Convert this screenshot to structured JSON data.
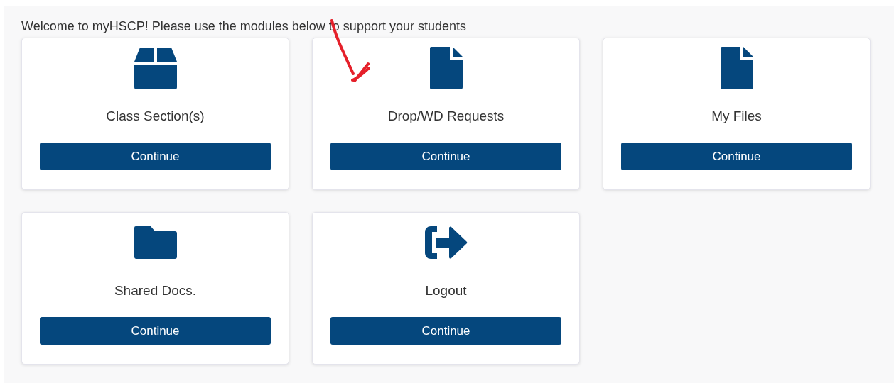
{
  "welcome": "Welcome to myHSCP! Please use the modules below to support your students",
  "modules": [
    {
      "kind": "box",
      "title": "Class Section(s)",
      "button": "Continue"
    },
    {
      "kind": "file",
      "title": "Drop/WD Requests",
      "button": "Continue"
    },
    {
      "kind": "file",
      "title": "My Files",
      "button": "Continue"
    },
    {
      "kind": "folder",
      "title": "Shared Docs.",
      "button": "Continue"
    },
    {
      "kind": "logout",
      "title": "Logout",
      "button": "Continue"
    }
  ]
}
